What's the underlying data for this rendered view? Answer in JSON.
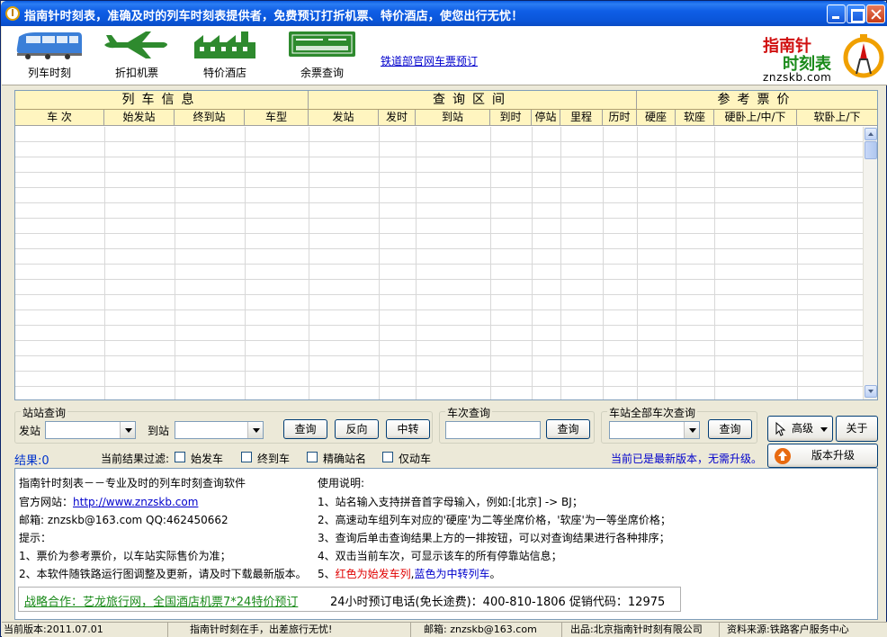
{
  "window": {
    "title": "指南针时刻表，准确及时的列车时刻表提供者，免费预订打折机票、特价酒店，使您出行无忧！"
  },
  "toolbar": {
    "items": [
      {
        "label": "列车时刻",
        "icon": "train-icon"
      },
      {
        "label": "折扣机票",
        "icon": "airplane-icon"
      },
      {
        "label": "特价酒店",
        "icon": "hotel-icon"
      },
      {
        "label": "余票查询",
        "icon": "ticket-icon"
      }
    ],
    "railway_link": "铁道部官网车票预订",
    "logo": {
      "line1": "指南针",
      "line2": "时刻表",
      "line3": "znzskb.com"
    }
  },
  "grid": {
    "groups": [
      "列车信息",
      "查询区间",
      "参考票价"
    ],
    "columns": [
      "车 次",
      "始发站",
      "终到站",
      "车型",
      "发站",
      "发时",
      "到站",
      "到时",
      "停站",
      "里程",
      "历时",
      "硬座",
      "软座",
      "硬卧上/中/下",
      "软卧上/下"
    ],
    "rows": []
  },
  "station_query": {
    "title": "站站查询",
    "from_label": "发站",
    "to_label": "到站",
    "from_value": "",
    "to_value": "",
    "query_button": "查询",
    "reverse_button": "反向",
    "transfer_button": "中转"
  },
  "train_query": {
    "title": "车次查询",
    "value": "",
    "query_button": "查询"
  },
  "station_all_query": {
    "title": "车站全部车次查询",
    "value": "",
    "query_button": "查询"
  },
  "side_buttons": {
    "advanced": "高级",
    "about": "关于",
    "upgrade": "版本升级"
  },
  "results": {
    "label": "结果:0",
    "filter_label": "当前结果过滤:",
    "filters": [
      "始发车",
      "终到车",
      "精确站名",
      "仅动车"
    ],
    "update_status": "当前已是最新版本，无需升级。"
  },
  "info": {
    "left": [
      "指南针时刻表－－专业及时的列车时刻查询软件",
      "官方网站：",
      "邮箱: znzskb@163.com QQ:462450662",
      "提示：",
      "1、票价为参考票价，以车站实际售价为准；",
      "2、本软件随铁路运行图调整及更新，请及时下载最新版本。"
    ],
    "website": "http://www.znzskb.com",
    "right": [
      "使用说明:",
      "1、站名输入支持拼音首字母输入，例如:[北京] -> BJ；",
      "2、高速动车组列车对应的'硬座'为二等坐席价格，'软座'为一等坐席价格；",
      "3、查询后单击查询结果上方的一排按钮，可以对查询结果进行各种排序；",
      "4、双击当前车次，可显示该车的所有停靠站信息；"
    ],
    "line5_prefix": "5、",
    "line5_red": "红色为始发车列",
    "line5_sep": ",",
    "line5_blue": "蓝色为中转列车",
    "line5_suffix": "。",
    "promo_link": "战略合作：艺龙旅行网，全国酒店机票7*24特价预订",
    "promo_phone": "24小时预订电话(免长途费)：400-810-1806 促销代码：12975"
  },
  "statusbar": {
    "version": "当前版本:2011.07.01",
    "slogan": "指南针时刻在手，出差旅行无忧!",
    "email": "邮箱: znzskb@163.com",
    "publisher": "出品:北京指南针时刻有限公司",
    "source": "资料来源:铁路客户服务中心"
  },
  "colors": {
    "titlebar": "#0a5ae0",
    "grid_header": "#fff5c0",
    "link": "#0000cc",
    "red_note": "#e00000",
    "blue_note": "#0000cc",
    "promo": "#1a8a1a"
  }
}
